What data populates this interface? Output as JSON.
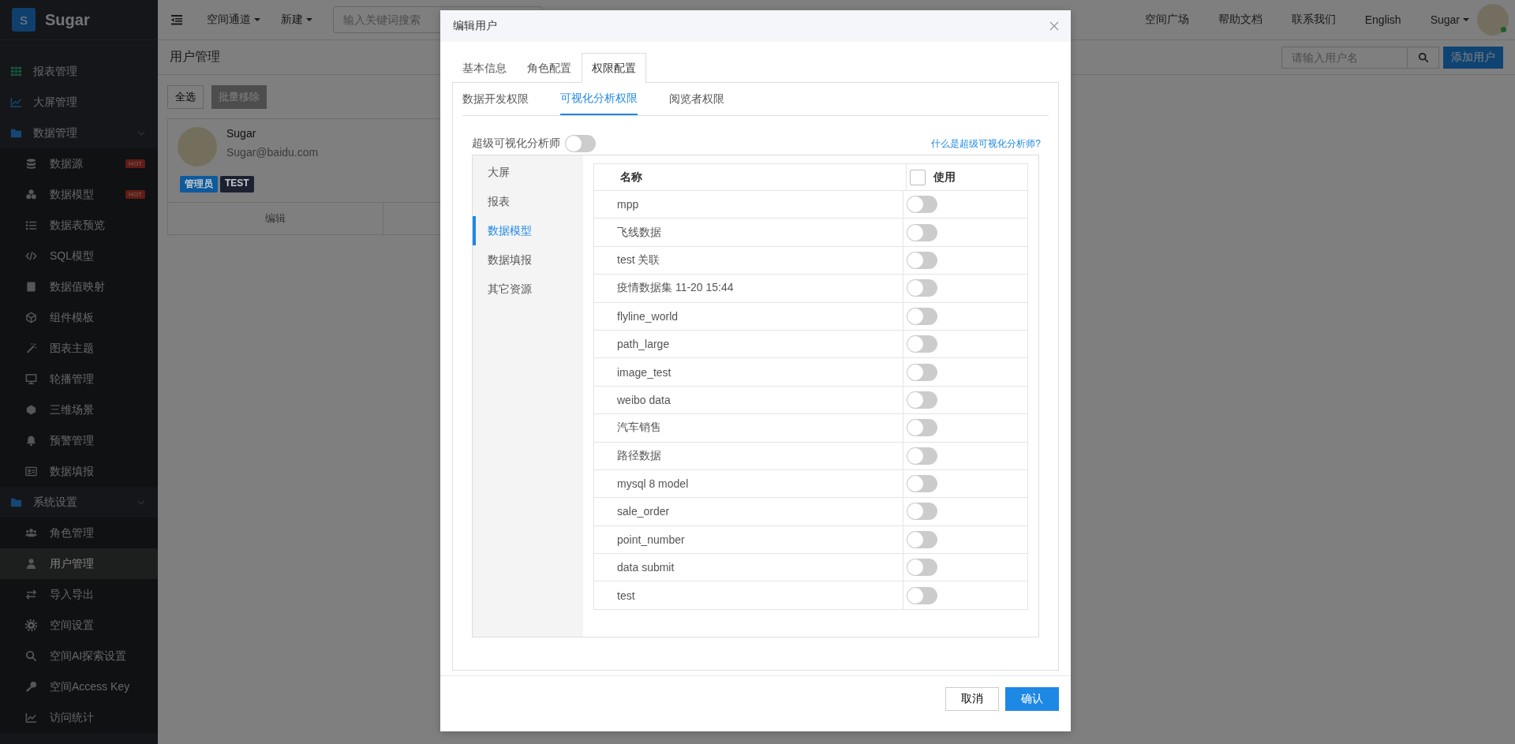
{
  "sidebar": {
    "logo": "S",
    "brand": "Sugar",
    "items": [
      {
        "label": "报表管理",
        "selected": false
      },
      {
        "label": "大屏管理",
        "selected": false
      },
      {
        "label": "数据管理",
        "selected": false,
        "expanded": true,
        "children": [
          {
            "label": "数据源",
            "badge": "HOT",
            "selected": false
          },
          {
            "label": "数据模型",
            "badge": "HOT",
            "selected": false
          },
          {
            "label": "数据表预览",
            "selected": false
          },
          {
            "label": "SQL模型",
            "selected": false
          },
          {
            "label": "数据值映射",
            "selected": false
          },
          {
            "label": "组件模板",
            "selected": false
          },
          {
            "label": "图表主题",
            "selected": false
          },
          {
            "label": "轮播管理",
            "selected": false
          },
          {
            "label": "三维场景",
            "selected": false
          },
          {
            "label": "预警管理",
            "selected": false
          },
          {
            "label": "数据填报",
            "selected": false
          }
        ]
      },
      {
        "label": "系统设置",
        "selected": false,
        "expanded": true,
        "children": [
          {
            "label": "角色管理",
            "selected": false
          },
          {
            "label": "用户管理",
            "selected": true
          },
          {
            "label": "导入导出",
            "selected": false
          },
          {
            "label": "空间设置",
            "selected": false
          },
          {
            "label": "空间AI探索设置",
            "selected": false
          },
          {
            "label": "空间Access Key",
            "selected": false
          },
          {
            "label": "访问统计",
            "selected": false
          }
        ]
      }
    ]
  },
  "top_bar": {
    "menus": [
      "空间通道",
      "新建"
    ],
    "search": {
      "placeholder": "输入关键词搜索"
    },
    "links": [
      "空间广场",
      "帮助文档",
      "联系我们",
      "English"
    ],
    "user": "Sugar"
  },
  "page": {
    "title": "用户管理",
    "search": {
      "placeholder": "请输入用户名"
    },
    "add_button": "添加用户",
    "select_all": "全选",
    "batch_remove": "批量移除",
    "users": [
      {
        "name": "Sugar",
        "email": "Sugar@baidu.com",
        "tags": [
          {
            "label": "管理员",
            "color": "#0d5a9c"
          },
          {
            "label": "TEST",
            "color": "#1b2130"
          }
        ],
        "actions": [
          "编辑"
        ]
      }
    ]
  },
  "dialog": {
    "title": "编辑用户",
    "tabs": [
      {
        "label": "基本信息",
        "selected": false
      },
      {
        "label": "角色配置",
        "selected": false
      },
      {
        "label": "权限配置",
        "selected": true
      }
    ],
    "sub_tabs": [
      {
        "label": "数据开发权限",
        "selected": false
      },
      {
        "label": "可视化分析权限",
        "selected": true
      },
      {
        "label": "阅览者权限",
        "selected": false
      }
    ],
    "super_analyst": {
      "label": "超级可视化分析师",
      "on": false
    },
    "help_link": "什么是超级可视化分析师?",
    "categories": [
      {
        "label": "大屏",
        "selected": false
      },
      {
        "label": "报表",
        "selected": false
      },
      {
        "label": "数据模型",
        "selected": true
      },
      {
        "label": "数据填报",
        "selected": false
      },
      {
        "label": "其它资源",
        "selected": false
      }
    ],
    "table": {
      "columns": [
        "名称",
        "使用"
      ],
      "select_all_checked": false,
      "rows": [
        {
          "name": "mpp",
          "on": false
        },
        {
          "name": "飞线数据",
          "on": false
        },
        {
          "name": "test 关联",
          "on": false
        },
        {
          "name": "疫情数据集 11-20 15:44",
          "on": false
        },
        {
          "name": "flyline_world",
          "on": false
        },
        {
          "name": "path_large",
          "on": false
        },
        {
          "name": "image_test",
          "on": false
        },
        {
          "name": "weibo data",
          "on": false
        },
        {
          "name": "汽车销售",
          "on": false
        },
        {
          "name": "路径数据",
          "on": false
        },
        {
          "name": "mysql 8 model",
          "on": false
        },
        {
          "name": "sale_order",
          "on": false
        },
        {
          "name": "point_number",
          "on": false
        },
        {
          "name": "data submit",
          "on": false
        },
        {
          "name": "test",
          "on": false
        }
      ]
    },
    "buttons": {
      "cancel": "取消",
      "confirm": "确认"
    }
  }
}
